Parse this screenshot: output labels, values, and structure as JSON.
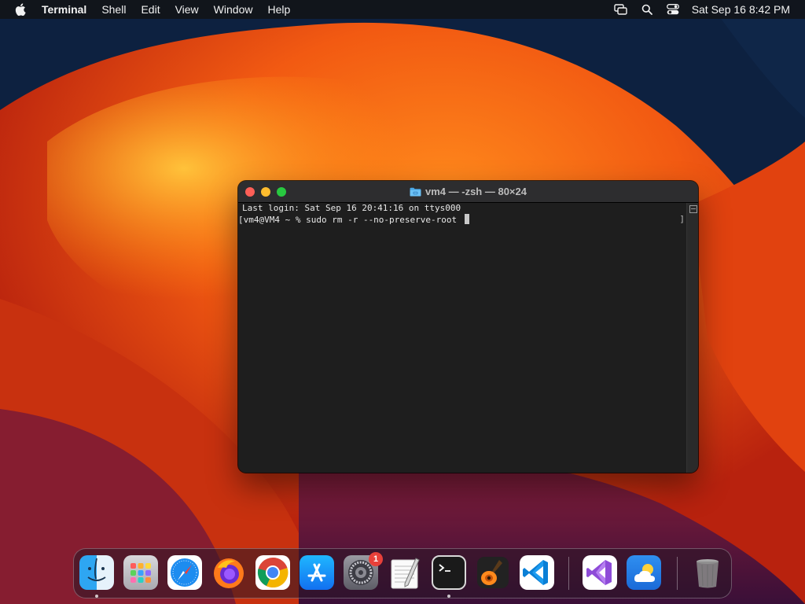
{
  "menubar": {
    "app_name": "Terminal",
    "menus": [
      "Shell",
      "Edit",
      "View",
      "Window",
      "Help"
    ],
    "clock": "Sat Sep 16  8:42 PM",
    "status_icons": [
      "screen-mirroring-icon",
      "search-icon",
      "control-center-icon"
    ]
  },
  "terminal": {
    "title": "vm4 — -zsh — 80×24",
    "lines": [
      "Last login: Sat Sep 16 20:41:16 on ttys000",
      "[vm4@VM4 ~ % sudo rm -r --no-preserve-root "
    ],
    "prompt_right_mark": "]"
  },
  "dock": {
    "apps": [
      {
        "name": "Finder",
        "icon": "finder-icon",
        "running": true
      },
      {
        "name": "Launchpad",
        "icon": "launchpad-icon",
        "running": false
      },
      {
        "name": "Safari",
        "icon": "safari-icon",
        "running": false
      },
      {
        "name": "Firefox",
        "icon": "firefox-icon",
        "running": false
      },
      {
        "name": "Google Chrome",
        "icon": "chrome-icon",
        "running": false
      },
      {
        "name": "App Store",
        "icon": "app-store-icon",
        "running": false
      },
      {
        "name": "System Settings",
        "icon": "system-settings-icon",
        "running": false,
        "badge": "1"
      },
      {
        "name": "TextEdit",
        "icon": "textedit-icon",
        "running": false
      },
      {
        "name": "Terminal",
        "icon": "terminal-icon",
        "running": true
      },
      {
        "name": "GarageBand",
        "icon": "garageband-icon",
        "running": false
      },
      {
        "name": "Visual Studio Code",
        "icon": "vscode-icon",
        "running": false
      },
      {
        "name": "Visual Studio",
        "icon": "visual-studio-icon",
        "running": false
      },
      {
        "name": "Weather",
        "icon": "weather-icon",
        "running": false
      },
      {
        "name": "Trash",
        "icon": "trash-icon",
        "running": false
      }
    ]
  },
  "colors": {
    "traffic_close": "#fe5f57",
    "traffic_minimize": "#febc2e",
    "traffic_zoom": "#28c840",
    "badge": "#e8403a"
  }
}
